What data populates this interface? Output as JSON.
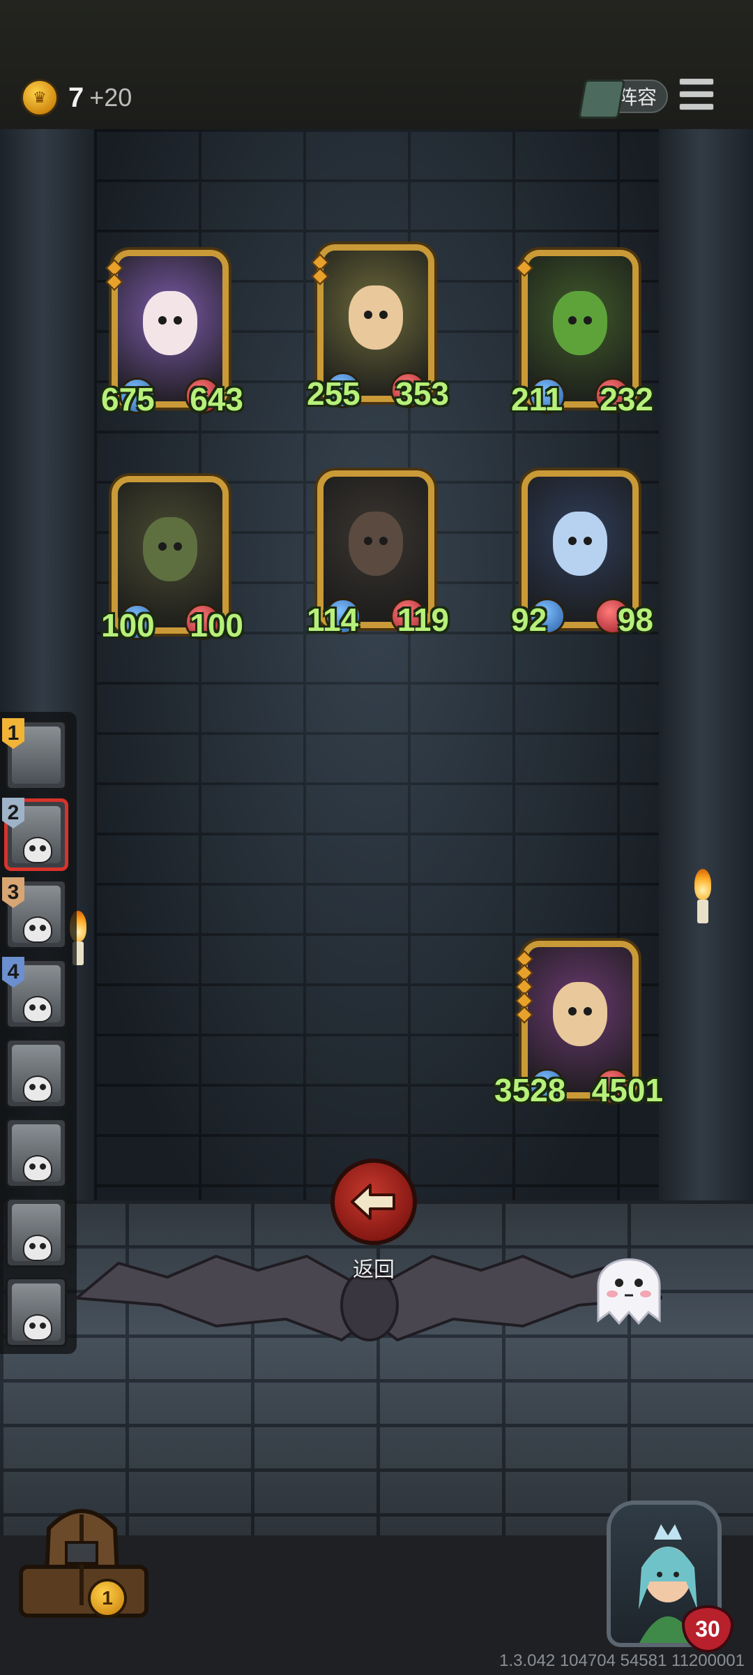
{
  "topbar": {
    "gold": "7",
    "gold_income": "+20",
    "lineup_label": "阵容",
    "coin_icon": "crown-coin-icon",
    "menu_icon": "hamburger-menu-icon"
  },
  "board": {
    "units": [
      {
        "name": "sorceress",
        "attack": "675",
        "health": "643",
        "stars": 2,
        "bg": "#7b5aa8",
        "skin": "#f3e4e8"
      },
      {
        "name": "sprout",
        "attack": "255",
        "health": "353",
        "stars": 2,
        "bg": "#6c6a3a",
        "skin": "#e9c89b"
      },
      {
        "name": "dryad",
        "attack": "211",
        "health": "232",
        "stars": 1,
        "bg": "#3f5a2a",
        "skin": "#5ea33a"
      },
      {
        "name": "goblin-mushroom",
        "attack": "100",
        "health": "100",
        "stars": 0,
        "bg": "#4a4a32",
        "skin": "#5e7040"
      },
      {
        "name": "treasure-mimic",
        "attack": "114",
        "health": "119",
        "stars": 0,
        "bg": "#3a3530",
        "skin": "#5a4a40"
      },
      {
        "name": "elf-witch",
        "attack": "92",
        "health": "98",
        "stars": 0,
        "bg": "#2f3e5a",
        "skin": "#b7d2f0"
      }
    ],
    "enemy": {
      "name": "sprout-boss",
      "attack": "3528",
      "health": "4501",
      "stars": 5,
      "bg": "#6a3a70",
      "skin": "#e9c89b"
    }
  },
  "roster": [
    {
      "num": "1",
      "color": "#f1b437",
      "selected": false,
      "skull": false
    },
    {
      "num": "2",
      "color": "#9fb3c8",
      "selected": true,
      "skull": true
    },
    {
      "num": "3",
      "color": "#d7a673",
      "selected": false,
      "skull": true
    },
    {
      "num": "4",
      "color": "#6b8fcf",
      "selected": false,
      "skull": true
    },
    {
      "num": "",
      "color": "",
      "selected": false,
      "skull": true
    },
    {
      "num": "",
      "color": "",
      "selected": false,
      "skull": true
    },
    {
      "num": "",
      "color": "",
      "selected": false,
      "skull": true
    },
    {
      "num": "",
      "color": "",
      "selected": false,
      "skull": true
    }
  ],
  "back_button": {
    "label": "返回",
    "icon": "arrow-left-icon"
  },
  "chest": {
    "count": "1",
    "icon": "treasure-chest-icon"
  },
  "hero": {
    "hp": "30",
    "icon": "fairy-queen-portrait"
  },
  "version": "1.3.042 104704 54581 11200001"
}
